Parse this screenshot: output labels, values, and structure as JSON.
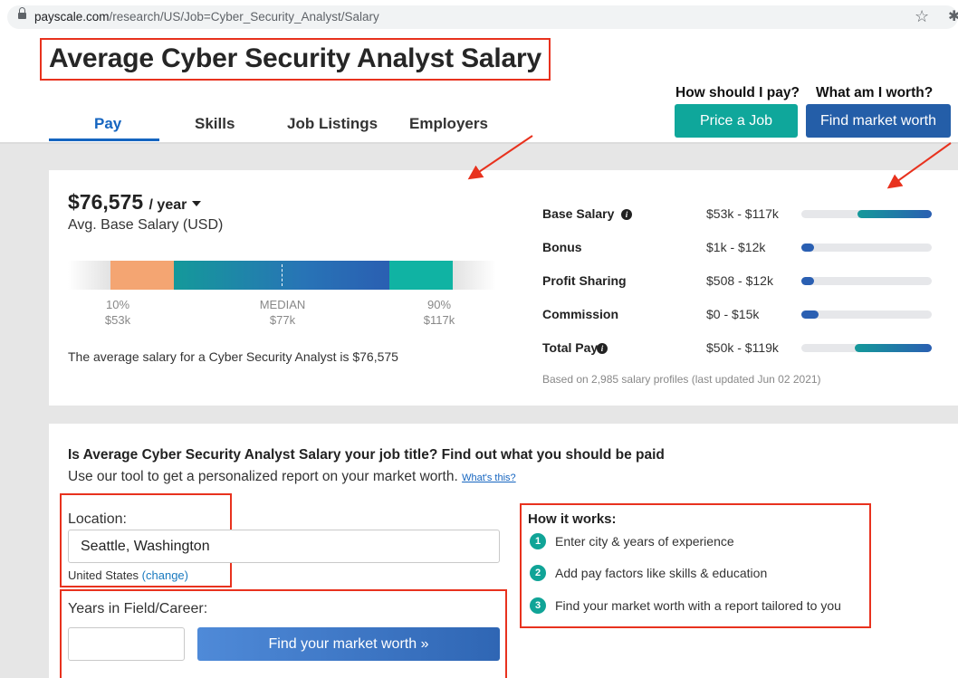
{
  "browser": {
    "url_host": "payscale.com",
    "url_path": "/research/US/Job=Cyber_Security_Analyst/Salary"
  },
  "header": {
    "title": "Average Cyber Security Analyst Salary",
    "tabs": [
      {
        "label": "Pay",
        "active": true
      },
      {
        "label": "Skills",
        "active": false
      },
      {
        "label": "Job Listings",
        "active": false
      },
      {
        "label": "Employers",
        "active": false
      }
    ],
    "cta": {
      "pay_question": "How should I pay?",
      "worth_question": "What am I worth?",
      "price_button": "Price a Job",
      "worth_button": "Find market worth"
    }
  },
  "summary": {
    "amount": "$76,575",
    "period": "/ year",
    "label": "Avg. Base Salary (USD)",
    "distribution": {
      "p10_label": "10%",
      "p10_value": "$53k",
      "median_label": "MEDIAN",
      "median_value": "$77k",
      "p90_label": "90%",
      "p90_value": "$117k"
    },
    "sentence": "The average salary for a Cyber Security Analyst is $76,575"
  },
  "compensation": [
    {
      "name": "Base Salary",
      "range": "$53k - $117k",
      "info": true,
      "start": 0.43,
      "end": 1.0
    },
    {
      "name": "Bonus",
      "range": "$1k - $12k",
      "info": false,
      "start": 0.0,
      "end": 0.1
    },
    {
      "name": "Profit Sharing",
      "range": "$508 - $12k",
      "info": false,
      "start": 0.0,
      "end": 0.1
    },
    {
      "name": "Commission",
      "range": "$0 - $15k",
      "info": false,
      "start": 0.0,
      "end": 0.13
    },
    {
      "name": "Total Pay",
      "range": "$50k - $119k",
      "info": true,
      "start": 0.41,
      "end": 1.0
    }
  ],
  "based_on": "Based on 2,985 salary profiles (last updated Jun 02 2021)",
  "tool": {
    "question": "Is Average Cyber Security Analyst Salary your job title? Find out what you should be paid",
    "subtitle": "Use our tool to get a personalized report on your market worth.",
    "whats_this": "What's this?",
    "location_label": "Location:",
    "location_value": "Seattle, Washington",
    "country": "United States",
    "change_link": "(change)",
    "years_label": "Years in Field/Career:",
    "years_value": "",
    "submit": "Find your market worth »"
  },
  "how_it_works": {
    "title": "How it works:",
    "steps": [
      {
        "num": "1",
        "text": "Enter city & years of experience"
      },
      {
        "num": "2",
        "text": "Add pay factors like skills & education"
      },
      {
        "num": "3",
        "text": "Find your market worth with a report tailored to you"
      }
    ]
  },
  "icons": {
    "lock": "lock-icon",
    "star": "star-icon",
    "extension": "extension-icon",
    "info": "info-icon",
    "caret": "caret-down-icon"
  },
  "colors": {
    "accent_blue": "#1565c0",
    "teal": "#0fa79b",
    "navy_button": "#245ea8",
    "annotation_red": "#e8321e",
    "orange_segment": "#f4a572"
  }
}
